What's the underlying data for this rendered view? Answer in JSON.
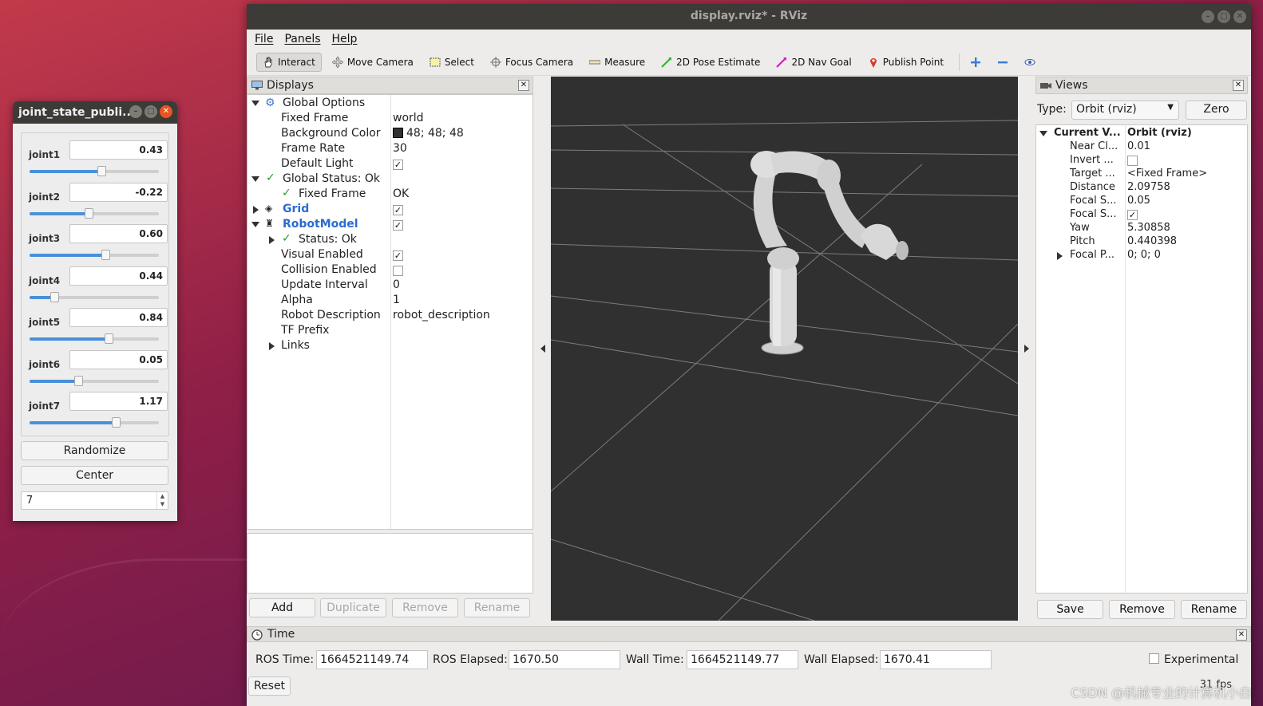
{
  "jsp": {
    "title": "joint_state_publi...",
    "joints": [
      {
        "label": "joint1",
        "value": "0.43",
        "fraction": 0.56
      },
      {
        "label": "joint2",
        "value": "-0.22",
        "fraction": 0.46
      },
      {
        "label": "joint3",
        "value": "0.60",
        "fraction": 0.59
      },
      {
        "label": "joint4",
        "value": "0.44",
        "fraction": 0.2
      },
      {
        "label": "joint5",
        "value": "0.84",
        "fraction": 0.62
      },
      {
        "label": "joint6",
        "value": "0.05",
        "fraction": 0.38
      },
      {
        "label": "joint7",
        "value": "1.17",
        "fraction": 0.67
      }
    ],
    "randomize_label": "Randomize",
    "center_label": "Center",
    "count_value": "7"
  },
  "rviz": {
    "title": "display.rviz* - RViz",
    "menu": {
      "file": "File",
      "panels": "Panels",
      "help": "Help"
    },
    "tools": {
      "interact": "Interact",
      "move_camera": "Move Camera",
      "select": "Select",
      "focus_camera": "Focus Camera",
      "measure": "Measure",
      "pose_estimate": "2D Pose Estimate",
      "nav_goal": "2D Nav Goal",
      "publish_point": "Publish Point"
    },
    "displays": {
      "title": "Displays",
      "global_options": "Global Options",
      "fixed_frame": {
        "k": "Fixed Frame",
        "v": "world"
      },
      "background_color": {
        "k": "Background Color",
        "v": "48; 48; 48"
      },
      "frame_rate": {
        "k": "Frame Rate",
        "v": "30"
      },
      "default_light": {
        "k": "Default Light",
        "v": "✓"
      },
      "global_status": "Global Status: Ok",
      "fixed_frame_status": {
        "k": "Fixed Frame",
        "v": "OK"
      },
      "grid": {
        "k": "Grid",
        "v": "✓"
      },
      "robot_model": {
        "k": "RobotModel",
        "v": "✓"
      },
      "status_ok": "Status: Ok",
      "visual_enabled": {
        "k": "Visual Enabled",
        "v": "✓"
      },
      "collision_enabled": {
        "k": "Collision Enabled",
        "v": ""
      },
      "update_interval": {
        "k": "Update Interval",
        "v": "0"
      },
      "alpha": {
        "k": "Alpha",
        "v": "1"
      },
      "robot_description": {
        "k": "Robot Description",
        "v": "robot_description"
      },
      "tf_prefix": {
        "k": "TF Prefix",
        "v": ""
      },
      "links": "Links",
      "buttons": {
        "add": "Add",
        "duplicate": "Duplicate",
        "remove": "Remove",
        "rename": "Rename"
      }
    },
    "views": {
      "title": "Views",
      "type_label": "Type:",
      "type_value": "Orbit (rviz)",
      "zero_label": "Zero",
      "current_view": {
        "k": "Current V...",
        "v": "Orbit (rviz)"
      },
      "rows": [
        {
          "k": "Near Cl...",
          "v": "0.01"
        },
        {
          "k": "Invert ...",
          "v": ""
        },
        {
          "k": "Target ...",
          "v": "<Fixed Frame>"
        },
        {
          "k": "Distance",
          "v": "2.09758"
        },
        {
          "k": "Focal S...",
          "v": "0.05"
        },
        {
          "k": "Focal S...",
          "v": "✓"
        },
        {
          "k": "Yaw",
          "v": "5.30858"
        },
        {
          "k": "Pitch",
          "v": "0.440398"
        },
        {
          "k": "Focal P...",
          "v": "0; 0; 0"
        }
      ],
      "buttons": {
        "save": "Save",
        "remove": "Remove",
        "rename": "Rename"
      }
    },
    "time": {
      "title": "Time",
      "ros_time_label": "ROS Time:",
      "ros_time": "1664521149.74",
      "ros_elapsed_label": "ROS Elapsed:",
      "ros_elapsed": "1670.50",
      "wall_time_label": "Wall Time:",
      "wall_time": "1664521149.77",
      "wall_elapsed_label": "Wall Elapsed:",
      "wall_elapsed": "1670.41",
      "experimental_label": "Experimental",
      "reset_label": "Reset",
      "fps": "31 fps"
    },
    "watermark": "CSDN @机械专业的计算机小白"
  }
}
